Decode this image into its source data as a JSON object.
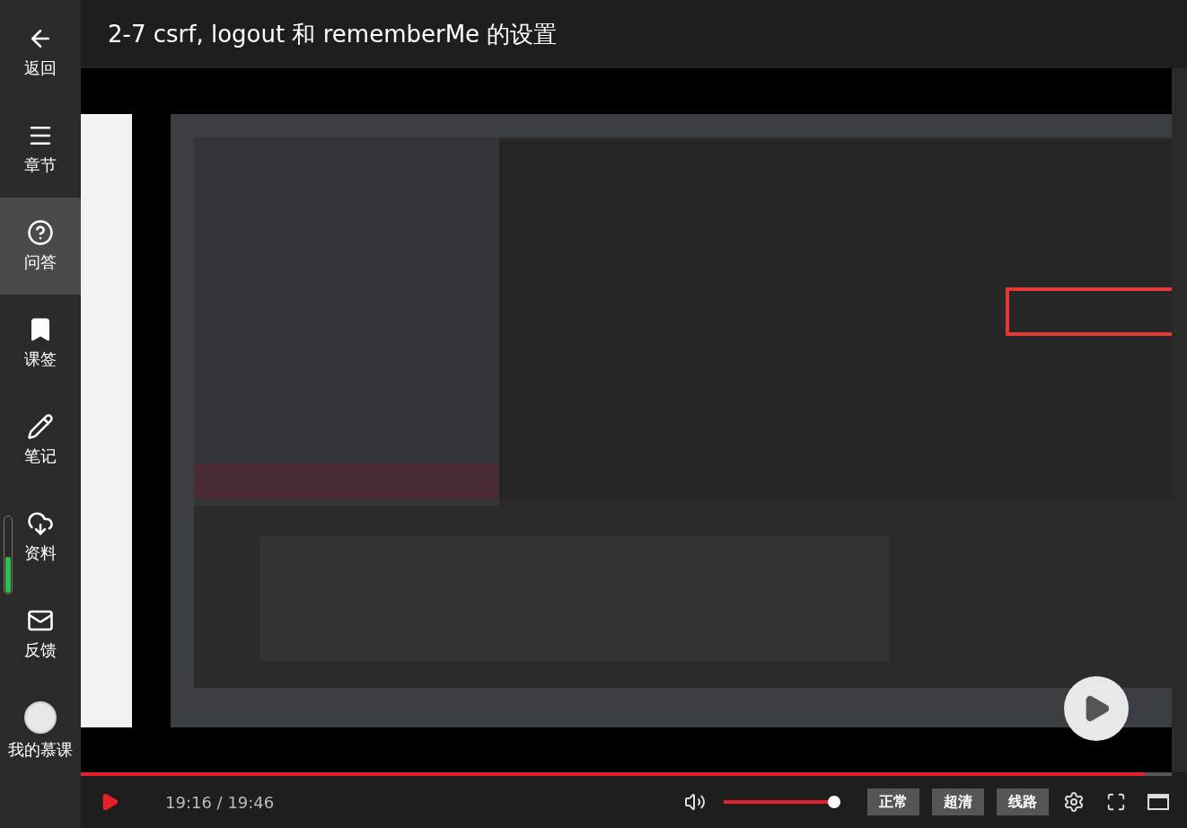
{
  "sidebar": {
    "items": [
      {
        "label": "返回",
        "selected": false
      },
      {
        "label": "章节",
        "selected": false
      },
      {
        "label": "问答",
        "selected": true
      },
      {
        "label": "课签",
        "selected": false
      },
      {
        "label": "笔记",
        "selected": false
      },
      {
        "label": "资料",
        "selected": false
      },
      {
        "label": "反馈",
        "selected": false
      },
      {
        "label": "我的慕课",
        "selected": false
      }
    ]
  },
  "title": "2-7 csrf, logout 和 rememberMe 的设置",
  "player": {
    "progress": {
      "level": 0.975
    },
    "time": "19:16 / 19:46",
    "volume": {
      "level": 0.95
    },
    "buttons": [
      "正常",
      "超清",
      "线路"
    ]
  }
}
